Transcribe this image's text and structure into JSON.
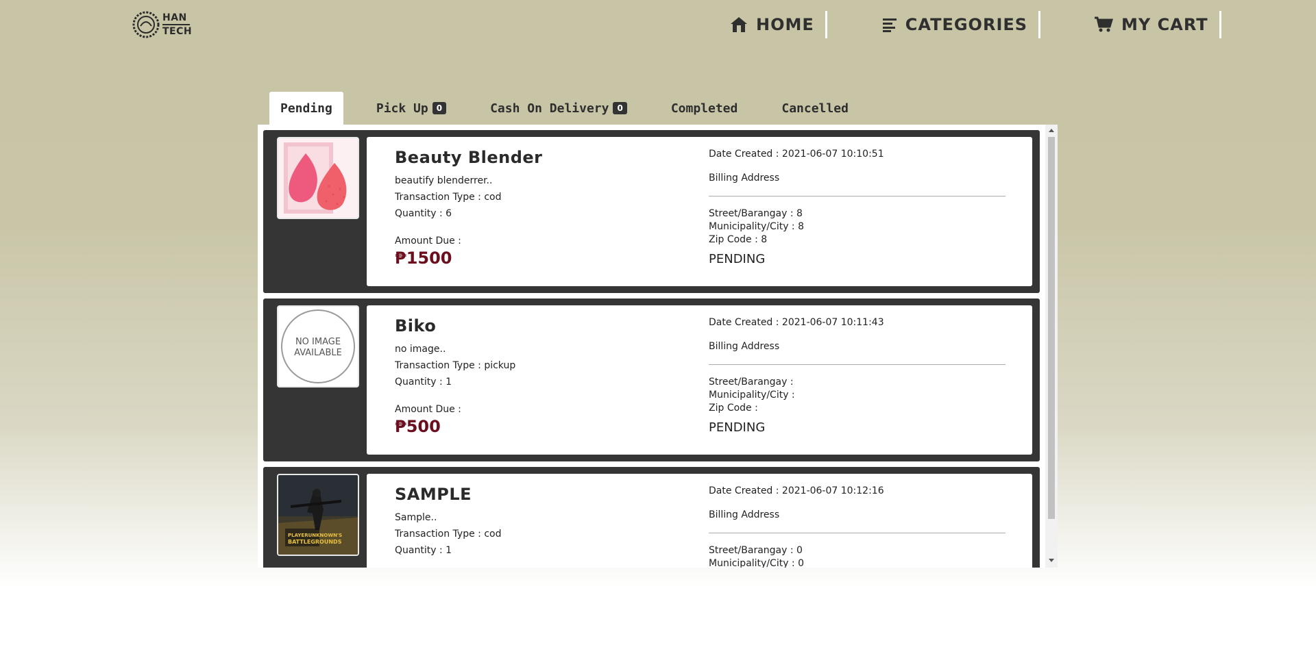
{
  "header": {
    "logo_line1": "HAN",
    "logo_line2": "TECH",
    "nav": [
      {
        "label": "HOME",
        "icon": "home-icon"
      },
      {
        "label": "CATEGORIES",
        "icon": "categories-icon"
      },
      {
        "label": "MY CART",
        "icon": "cart-icon"
      }
    ]
  },
  "tabs": [
    {
      "label": "Pending",
      "badge": null,
      "active": true
    },
    {
      "label": "Pick Up",
      "badge": "0",
      "active": false
    },
    {
      "label": "Cash On Delivery",
      "badge": "0",
      "active": false
    },
    {
      "label": "Completed",
      "badge": null,
      "active": false
    },
    {
      "label": "Cancelled",
      "badge": null,
      "active": false
    }
  ],
  "orders": [
    {
      "name": "Beauty Blender",
      "description": "beautify blenderrer..",
      "transaction_type": "Transaction Type : cod",
      "quantity": "Quantity : 6",
      "amount_label": "Amount Due :",
      "amount": "₱1500",
      "date_created": "Date Created : 2021-06-07 10:10:51",
      "billing_label": "Billing Address",
      "street": "Street/Barangay : 8",
      "city": "Municipality/City : 8",
      "zip": "Zip Code : 8",
      "status": "PENDING",
      "image": "beauty-blender-image"
    },
    {
      "name": "Biko",
      "description": "no image..",
      "transaction_type": "Transaction Type : pickup",
      "quantity": "Quantity : 1",
      "amount_label": "Amount Due :",
      "amount": "₱500",
      "date_created": "Date Created : 2021-06-07 10:11:43",
      "billing_label": "Billing Address",
      "street": "Street/Barangay :",
      "city": "Municipality/City :",
      "zip": "Zip Code :",
      "status": "PENDING",
      "image": "no-image-available",
      "image_text_1": "NO IMAGE",
      "image_text_2": "AVAILABLE"
    },
    {
      "name": "SAMPLE",
      "description": "Sample..",
      "transaction_type": "Transaction Type : cod",
      "quantity": "Quantity : 1",
      "amount_label": "Amount Due :",
      "amount": "",
      "date_created": "Date Created : 2021-06-07 10:12:16",
      "billing_label": "Billing Address",
      "street": "Street/Barangay : 0",
      "city": "Municipality/City : 0",
      "zip": "",
      "status": "",
      "image": "battlegrounds-image"
    }
  ],
  "colors": {
    "amount": "#6b0f1f",
    "order_bg": "#353535",
    "page_bg": "#c8c4a6"
  }
}
